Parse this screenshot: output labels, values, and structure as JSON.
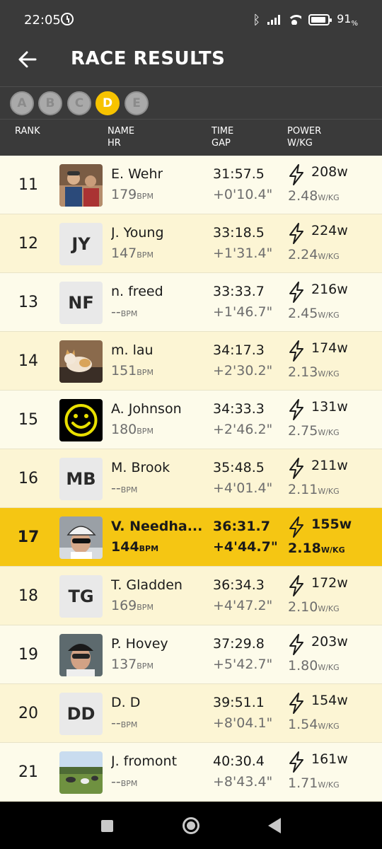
{
  "status_bar": {
    "time": "22:05",
    "battery": "91",
    "battery_unit": "%"
  },
  "header": {
    "title": "RACE RESULTS"
  },
  "categories": [
    "A",
    "B",
    "C",
    "D",
    "E"
  ],
  "active_category": "D",
  "columns": {
    "rank": "RANK",
    "name": "NAME",
    "hr": "HR",
    "time": "TIME",
    "gap": "GAP",
    "power": "POWER",
    "wkg": "W/KG"
  },
  "units": {
    "bpm": "BPM",
    "wkg": "W/KG"
  },
  "rows": [
    {
      "rank": "11",
      "name": "E. Wehr",
      "hr": "179",
      "time": "31:57.5",
      "gap": "+0'10.4\"",
      "power": "208w",
      "wkg": "2.48",
      "avatar": "photo-cyclists",
      "initials": ""
    },
    {
      "rank": "12",
      "name": "J. Young",
      "hr": "147",
      "time": "33:18.5",
      "gap": "+1'31.4\"",
      "power": "224w",
      "wkg": "2.24",
      "avatar": "initials",
      "initials": "JY"
    },
    {
      "rank": "13",
      "name": "n. freed",
      "hr": "--",
      "time": "33:33.7",
      "gap": "+1'46.7\"",
      "power": "216w",
      "wkg": "2.45",
      "avatar": "initials",
      "initials": "NF"
    },
    {
      "rank": "14",
      "name": "m. lau",
      "hr": "151",
      "time": "34:17.3",
      "gap": "+2'30.2\"",
      "power": "174w",
      "wkg": "2.13",
      "avatar": "photo-cat",
      "initials": ""
    },
    {
      "rank": "15",
      "name": "A. Johnson",
      "hr": "180",
      "time": "34:33.3",
      "gap": "+2'46.2\"",
      "power": "131w",
      "wkg": "2.75",
      "avatar": "smiley",
      "initials": ""
    },
    {
      "rank": "16",
      "name": "M. Brook",
      "hr": "--",
      "time": "35:48.5",
      "gap": "+4'01.4\"",
      "power": "211w",
      "wkg": "2.11",
      "avatar": "initials",
      "initials": "MB"
    },
    {
      "rank": "17",
      "name": "V. Needha...",
      "hr": "144",
      "time": "36:31.7",
      "gap": "+4'44.7\"",
      "power": "155w",
      "wkg": "2.18",
      "avatar": "photo-helmet",
      "initials": "",
      "highlight": true
    },
    {
      "rank": "18",
      "name": "T. Gladden",
      "hr": "169",
      "time": "36:34.3",
      "gap": "+4'47.2\"",
      "power": "172w",
      "wkg": "2.10",
      "avatar": "initials",
      "initials": "TG"
    },
    {
      "rank": "19",
      "name": "P. Hovey",
      "hr": "137",
      "time": "37:29.8",
      "gap": "+5'42.7\"",
      "power": "203w",
      "wkg": "1.80",
      "avatar": "photo-cap",
      "initials": ""
    },
    {
      "rank": "20",
      "name": "D.  D",
      "hr": "--",
      "time": "39:51.1",
      "gap": "+8'04.1\"",
      "power": "154w",
      "wkg": "1.54",
      "avatar": "initials",
      "initials": "DD"
    },
    {
      "rank": "21",
      "name": "J. fromont",
      "hr": "--",
      "time": "40:30.4",
      "gap": "+8'43.4\"",
      "power": "161w",
      "wkg": "1.71",
      "avatar": "photo-cows",
      "initials": ""
    }
  ],
  "colors": {
    "accent": "#f5c613",
    "row_odd": "#fdfbea",
    "row_even": "#fcf5d4",
    "header_bg": "#3a3a3a"
  }
}
